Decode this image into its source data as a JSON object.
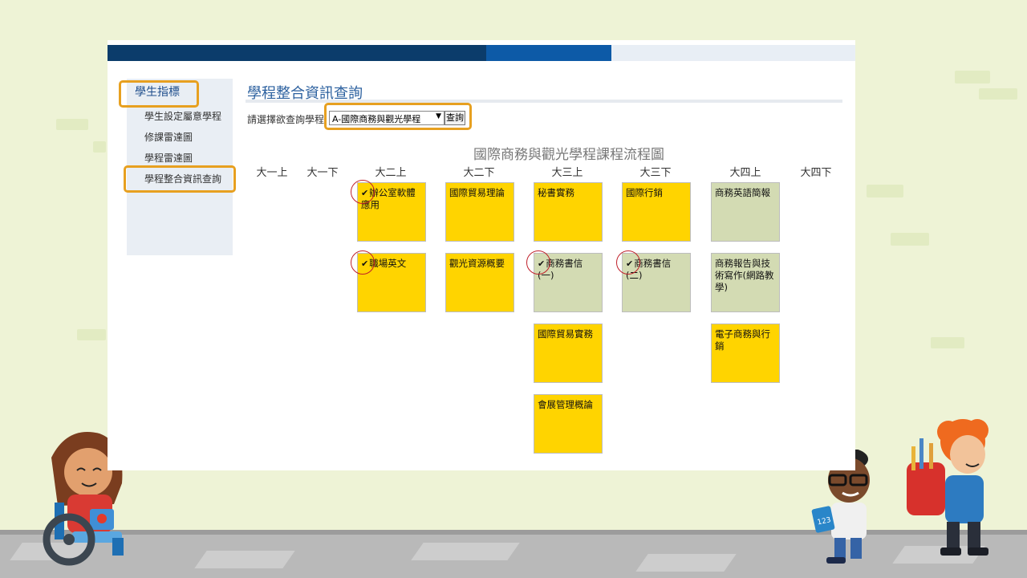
{
  "sidebar": {
    "title": "學生指標",
    "items": [
      {
        "label": "學生設定屬意學程"
      },
      {
        "label": "修課雷達圖"
      },
      {
        "label": "學程雷達圖"
      },
      {
        "label": "學程整合資訊查詢"
      }
    ]
  },
  "page": {
    "title": "學程整合資訊查詢",
    "query_label": "請選擇欲查詢學程",
    "selected_program": "A-國際商務與觀光學程",
    "query_button": "查詢"
  },
  "flow": {
    "title": "國際商務與觀光學程課程流程圖",
    "semesters": [
      "大一上",
      "大一下",
      "大二上",
      "大二下",
      "大三上",
      "大三下",
      "大四上",
      "大四下"
    ],
    "courses": {
      "c1": {
        "name": "辦公室軟體應用",
        "checked": true,
        "color": "yellow"
      },
      "c2": {
        "name": "職場英文",
        "checked": true,
        "color": "yellow"
      },
      "c3": {
        "name": "國際貿易理論",
        "checked": false,
        "color": "yellow"
      },
      "c4": {
        "name": "觀光資源概要",
        "checked": false,
        "color": "yellow"
      },
      "c5": {
        "name": "秘書實務",
        "checked": false,
        "color": "yellow"
      },
      "c6": {
        "name": "商務書信(一)",
        "checked": true,
        "color": "green"
      },
      "c7": {
        "name": "國際貿易實務",
        "checked": false,
        "color": "yellow"
      },
      "c8": {
        "name": "會展管理概論",
        "checked": false,
        "color": "yellow"
      },
      "c9": {
        "name": "國際行銷",
        "checked": false,
        "color": "yellow"
      },
      "c10": {
        "name": "商務書信(二)",
        "checked": true,
        "color": "green"
      },
      "c11": {
        "name": "商務英語簡報",
        "checked": false,
        "color": "green"
      },
      "c12": {
        "name": "商務報告與技術寫作(網路教學)",
        "checked": false,
        "color": "green"
      },
      "c13": {
        "name": "電子商務與行銷",
        "checked": false,
        "color": "yellow"
      }
    },
    "check_mark": "✔"
  },
  "colors": {
    "nav_dark": "#0b3c6b",
    "nav_mid": "#0d5aa7",
    "highlight": "#e7a020",
    "card_yellow": "#ffd400",
    "card_green": "#d3dbb3",
    "check_circle": "#c0202a"
  }
}
